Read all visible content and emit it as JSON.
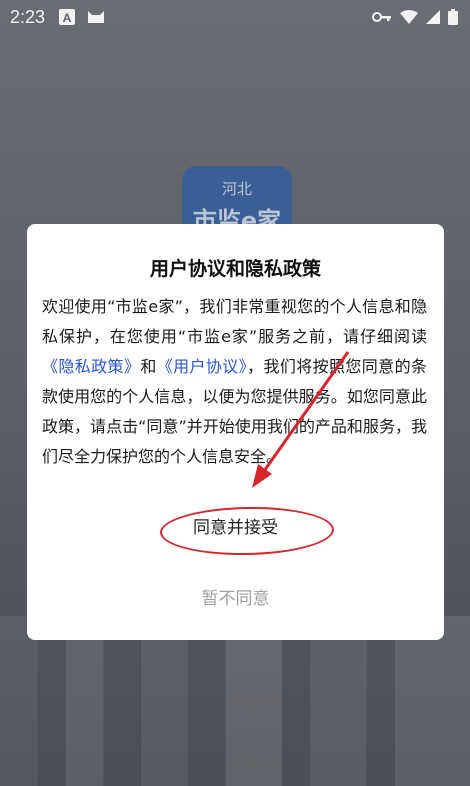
{
  "status_bar": {
    "time": "2:23",
    "icons": [
      "a-notification-icon",
      "android-cat-icon",
      "vpn-key-icon",
      "wifi-icon",
      "signal-icon",
      "battery-icon"
    ]
  },
  "background_app": {
    "logo_line1": "河北",
    "logo_line2": "市监e家"
  },
  "dialog": {
    "title": "用户协议和隐私政策",
    "body_part1": "欢迎使用“市监e家”，我们非常重视您的个人信息和隐私保护，在您使用“市监e家”服务之前，请仔细阅读",
    "privacy_link": "《隐私政策》",
    "body_and": "和",
    "user_agreement_link": "《用户协议》",
    "body_part2": "，我们将按照您同意的条款使用您的个人信息，以便为您提供服务。如您同意此政策，请点击“同意”并开始使用我们的产品和服务，我们尽全力保护您的个人信息安全。",
    "agree_label": "同意并接受",
    "decline_label": "暂不同意"
  },
  "colors": {
    "link": "#2855d6",
    "annotation": "#d6262c",
    "overlay": "#5a5d66"
  }
}
